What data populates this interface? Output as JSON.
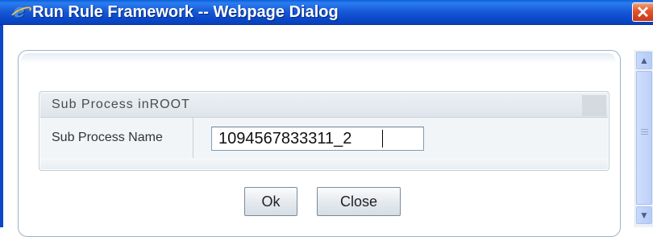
{
  "window": {
    "title": "Run Rule Framework -- Webpage Dialog",
    "app_icon": "internet-explorer-icon",
    "close_glyph": "✕"
  },
  "section": {
    "title": "Sub Process inROOT"
  },
  "form": {
    "sub_process_name_label": "Sub Process Name",
    "sub_process_name_value": "1094567833311_2"
  },
  "buttons": {
    "ok_label": "Ok",
    "close_label": "Close"
  },
  "scrollbar": {
    "up_glyph": "▲",
    "down_glyph": "▼"
  },
  "colors": {
    "titlebar": "#0a47c9",
    "close_button": "#e0542a",
    "section_header": "#dfe5eb"
  }
}
